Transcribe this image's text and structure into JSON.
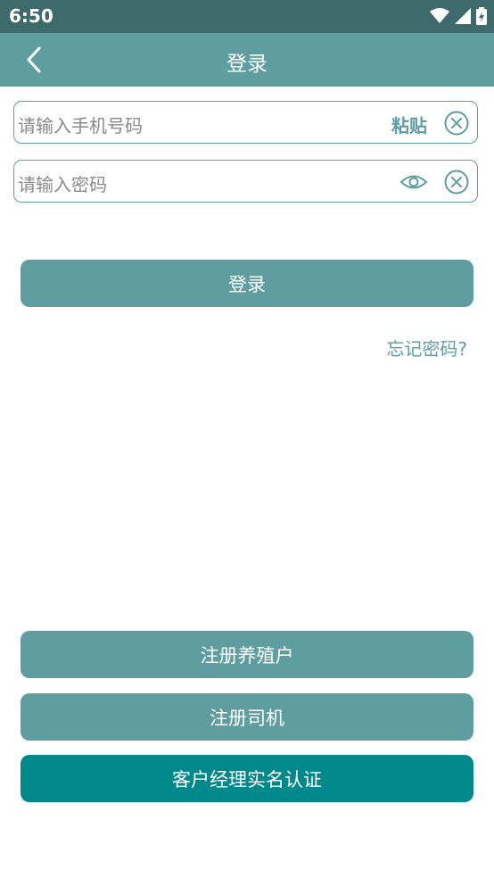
{
  "status": {
    "time": "6:50"
  },
  "appbar": {
    "title": "登录"
  },
  "phone": {
    "placeholder": "请输入手机号码",
    "paste_label": "粘贴"
  },
  "password": {
    "placeholder": "请输入密码"
  },
  "login_button": "登录",
  "forgot_link": "忘记密码?",
  "register_farmer": "注册养殖户",
  "register_driver": "注册司机",
  "manager_verify": "客户经理实名认证",
  "colors": {
    "primary": "#5f9ea0",
    "dark_accent": "#00898a",
    "statusbar": "#3f6a6b"
  }
}
